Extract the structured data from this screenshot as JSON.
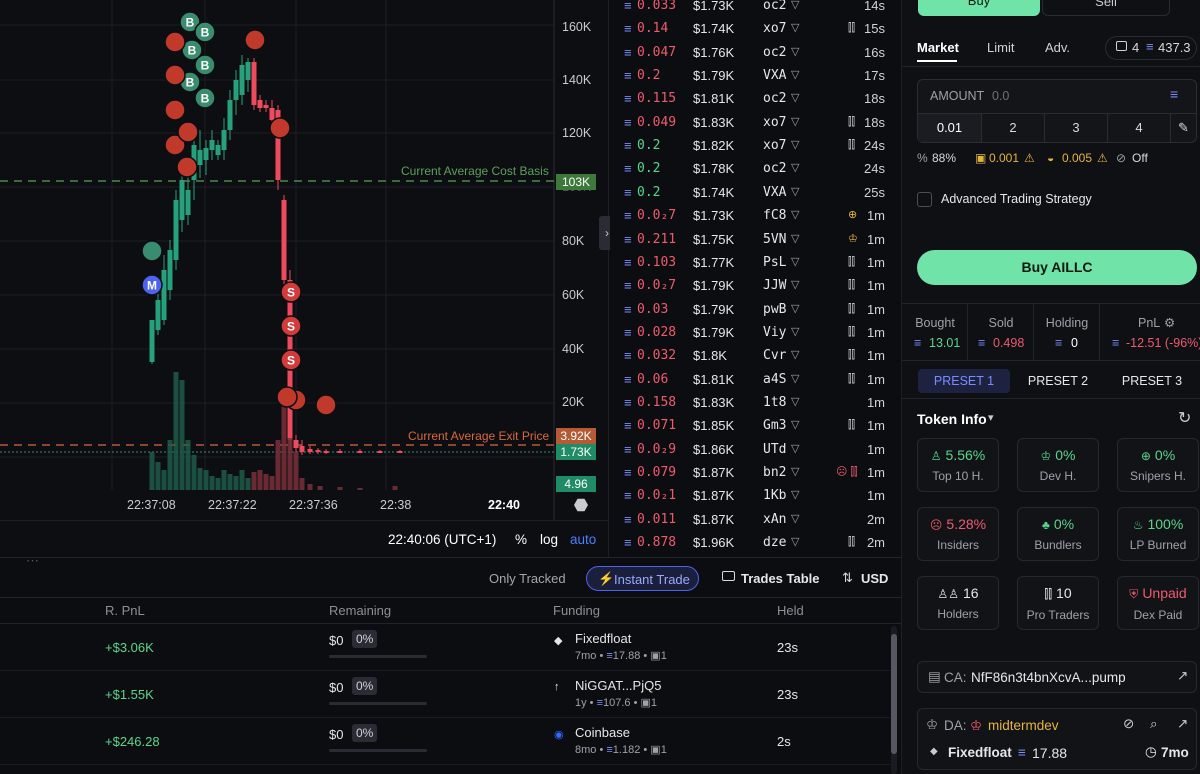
{
  "chart": {
    "y_ticks": [
      "160K",
      "140K",
      "120K",
      "100K",
      "80K",
      "60K",
      "40K",
      "20K"
    ],
    "x_ticks": [
      "22:37:08",
      "22:37:22",
      "22:37:36",
      "22:38",
      "22:40"
    ],
    "avg_cost_label": "Current Average Cost Basis",
    "avg_exit_label": "Current Average Exit Price",
    "price_avg_cost": "103K",
    "price_avg_exit": "3.92K",
    "price_current": "1.73K",
    "volume_value": "4.96",
    "colors": {
      "up": "#26a17b",
      "down": "#ef4b5f",
      "cost_line": "#5aa05a",
      "exit_line": "#d9683d"
    },
    "footer": {
      "time": "22:40:06 (UTC+1)",
      "percent": "%",
      "log": "log",
      "auto": "auto"
    },
    "markers": {
      "buy": "B",
      "sell": "S",
      "migration": "M"
    }
  },
  "trades": [
    {
      "amount": "0.033",
      "value": "$1.73K",
      "maker": "oc2",
      "age": "14s",
      "side": "sell",
      "icon": ""
    },
    {
      "amount": "0.14",
      "value": "$1.74K",
      "maker": "xo7",
      "age": "15s",
      "side": "sell",
      "icon": "pro-trader-icon"
    },
    {
      "amount": "0.047",
      "value": "$1.76K",
      "maker": "oc2",
      "age": "16s",
      "side": "sell",
      "icon": ""
    },
    {
      "amount": "0.2",
      "value": "$1.79K",
      "maker": "VXA",
      "age": "17s",
      "side": "sell",
      "icon": ""
    },
    {
      "amount": "0.115",
      "value": "$1.81K",
      "maker": "oc2",
      "age": "18s",
      "side": "sell",
      "icon": ""
    },
    {
      "amount": "0.049",
      "value": "$1.83K",
      "maker": "xo7",
      "age": "18s",
      "side": "sell",
      "icon": "pro-trader-icon"
    },
    {
      "amount": "0.2",
      "value": "$1.82K",
      "maker": "xo7",
      "age": "24s",
      "side": "buy",
      "icon": "pro-trader-icon"
    },
    {
      "amount": "0.2",
      "value": "$1.78K",
      "maker": "oc2",
      "age": "24s",
      "side": "buy",
      "icon": ""
    },
    {
      "amount": "0.2",
      "value": "$1.74K",
      "maker": "VXA",
      "age": "25s",
      "side": "buy",
      "icon": ""
    },
    {
      "amount": "0.0₂7",
      "value": "$1.73K",
      "maker": "fC8",
      "age": "1m",
      "side": "sell",
      "icon": "sniper-icon"
    },
    {
      "amount": "0.211",
      "value": "$1.75K",
      "maker": "5VN",
      "age": "1m",
      "side": "sell",
      "icon": "dev-icon"
    },
    {
      "amount": "0.103",
      "value": "$1.77K",
      "maker": "PsL",
      "age": "1m",
      "side": "sell",
      "icon": "pro-trader-icon"
    },
    {
      "amount": "0.0₂7",
      "value": "$1.79K",
      "maker": "JJW",
      "age": "1m",
      "side": "sell",
      "icon": "pro-trader-icon"
    },
    {
      "amount": "0.03",
      "value": "$1.79K",
      "maker": "pwB",
      "age": "1m",
      "side": "sell",
      "icon": "pro-trader-icon"
    },
    {
      "amount": "0.028",
      "value": "$1.79K",
      "maker": "Viy",
      "age": "1m",
      "side": "sell",
      "icon": "pro-trader-icon"
    },
    {
      "amount": "0.032",
      "value": "$1.8K",
      "maker": "Cvr",
      "age": "1m",
      "side": "sell",
      "icon": "pro-trader-icon"
    },
    {
      "amount": "0.06",
      "value": "$1.81K",
      "maker": "a4S",
      "age": "1m",
      "side": "sell",
      "icon": "pro-trader-icon"
    },
    {
      "amount": "0.158",
      "value": "$1.83K",
      "maker": "1t8",
      "age": "1m",
      "side": "sell",
      "icon": ""
    },
    {
      "amount": "0.071",
      "value": "$1.85K",
      "maker": "Gm3",
      "age": "1m",
      "side": "sell",
      "icon": "pro-trader-icon"
    },
    {
      "amount": "0.0₂9",
      "value": "$1.86K",
      "maker": "UTd",
      "age": "1m",
      "side": "sell",
      "icon": ""
    },
    {
      "amount": "0.079",
      "value": "$1.87K",
      "maker": "bn2",
      "age": "1m",
      "side": "sell",
      "icon": "insider-pro-icon"
    },
    {
      "amount": "0.0₂1",
      "value": "$1.87K",
      "maker": "1Kb",
      "age": "1m",
      "side": "sell",
      "icon": ""
    },
    {
      "amount": "0.011",
      "value": "$1.87K",
      "maker": "xAn",
      "age": "2m",
      "side": "sell",
      "icon": ""
    },
    {
      "amount": "0.878",
      "value": "$1.96K",
      "maker": "dze",
      "age": "2m",
      "side": "sell",
      "icon": "pro-trader-icon"
    }
  ],
  "toolbar": {
    "only_tracked": "Only Tracked",
    "instant_trade": "Instant Trade",
    "trades_table": "Trades Table",
    "currency": "USD"
  },
  "positions": {
    "headers": {
      "rpnl": "R. PnL",
      "remaining": "Remaining",
      "funding": "Funding",
      "held": "Held"
    },
    "rows": [
      {
        "rpnl": "+$3.06K",
        "remaining": "$0",
        "remaining_pct": "0%",
        "remaining_fill": 0,
        "funding_name": "Fixedfloat",
        "funding_age": "7mo",
        "funding_amount": "17.88",
        "funding_count": "1",
        "held": "23s"
      },
      {
        "rpnl": "+$1.55K",
        "remaining": "$0",
        "remaining_pct": "0%",
        "remaining_fill": 0,
        "funding_name": "NiGGAT...PjQ5",
        "funding_age": "1y",
        "funding_amount": "107.6",
        "funding_count": "1",
        "held": "23s"
      },
      {
        "rpnl": "+$246.28",
        "remaining": "$0",
        "remaining_pct": "0%",
        "remaining_fill": 0,
        "funding_name": "Coinbase",
        "funding_age": "8mo",
        "funding_amount": "1.182",
        "funding_count": "1",
        "held": "2s"
      }
    ]
  },
  "panel": {
    "buy_tab": "Buy",
    "sell_tab": "Sell",
    "order_tabs": [
      "Market",
      "Limit",
      "Adv."
    ],
    "wallet_count": "4",
    "wallet_balance": "437.3",
    "amount_label": "AMOUNT",
    "amount_placeholder": "0.0",
    "presets": [
      "0.01",
      "2",
      "3",
      "4"
    ],
    "slippage": "88%",
    "priority_fee": "0.001",
    "bribe": "0.005",
    "mev": "Off",
    "advanced_strategy": "Advanced Trading Strategy",
    "buy_button": "Buy AILLC",
    "stats": {
      "bought_label": "Bought",
      "bought": "13.01",
      "sold_label": "Sold",
      "sold": "0.498",
      "holding_label": "Holding",
      "holding": "0",
      "pnl_label": "PnL",
      "pnl": "-12.51 (-96%)"
    },
    "preset_tabs": [
      "PRESET 1",
      "PRESET 2",
      "PRESET 3"
    ],
    "token_info_title": "Token Info",
    "cards": [
      {
        "value": "5.56%",
        "label": "Top 10 H.",
        "color": "#58d68d",
        "icon": "user-icon"
      },
      {
        "value": "0%",
        "label": "Dev H.",
        "color": "#58d68d",
        "icon": "chef-icon"
      },
      {
        "value": "0%",
        "label": "Snipers H.",
        "color": "#58d68d",
        "icon": "crosshair-icon"
      },
      {
        "value": "5.28%",
        "label": "Insiders",
        "color": "#ef5a6f",
        "icon": "ghost-icon"
      },
      {
        "value": "0%",
        "label": "Bundlers",
        "color": "#58d68d",
        "icon": "bundle-icon"
      },
      {
        "value": "100%",
        "label": "LP Burned",
        "color": "#58d68d",
        "icon": "flame-icon"
      },
      {
        "value": "16",
        "label": "Holders",
        "color": "#e6e7ea",
        "icon": "users-icon"
      },
      {
        "value": "10",
        "label": "Pro Traders",
        "color": "#e6e7ea",
        "icon": "candles-icon"
      },
      {
        "value": "Unpaid",
        "label": "Dex Paid",
        "color": "#ef5a6f",
        "icon": "shield-icon"
      }
    ],
    "ca_label": "CA:",
    "ca_value": "NfF86n3t4bnXcvA...pump",
    "da_label": "DA:",
    "da_value": "midtermdev",
    "funding_source": "Fixedfloat",
    "funding_amount": "17.88",
    "funding_age": "7mo"
  }
}
